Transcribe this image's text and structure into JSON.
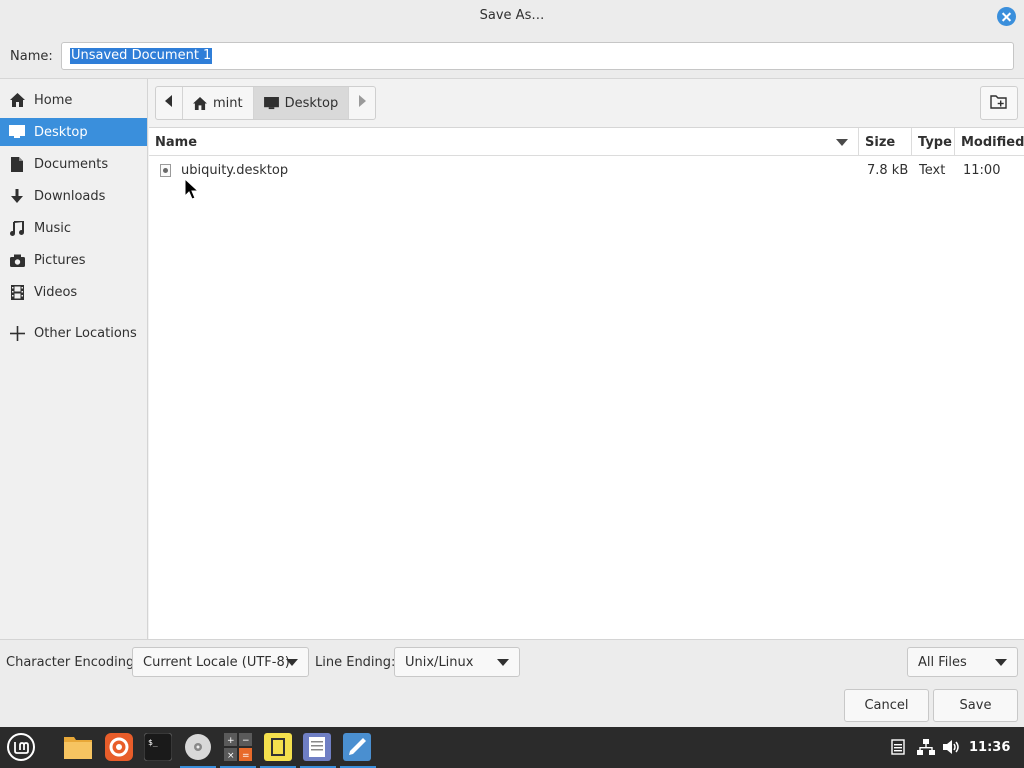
{
  "window": {
    "title": "Save As…"
  },
  "name_row": {
    "label": "Name:",
    "value": "Unsaved Document 1"
  },
  "sidebar": {
    "items": [
      {
        "label": "Home",
        "icon": "home-icon",
        "active": false
      },
      {
        "label": "Desktop",
        "icon": "desktop-icon",
        "active": true
      },
      {
        "label": "Documents",
        "icon": "document-icon",
        "active": false
      },
      {
        "label": "Downloads",
        "icon": "download-icon",
        "active": false
      },
      {
        "label": "Music",
        "icon": "music-icon",
        "active": false
      },
      {
        "label": "Pictures",
        "icon": "camera-icon",
        "active": false
      },
      {
        "label": "Videos",
        "icon": "film-icon",
        "active": false
      },
      {
        "label": "Other Locations",
        "icon": "plus-icon",
        "active": false
      }
    ]
  },
  "pathbar": {
    "items": [
      {
        "label": "mint",
        "icon": "home-icon"
      },
      {
        "label": "Desktop",
        "icon": "desktop-icon",
        "current": true
      }
    ]
  },
  "filelist": {
    "columns": [
      "Name",
      "Size",
      "Type",
      "Modified"
    ],
    "rows": [
      {
        "name": "ubiquity.desktop",
        "size": "7.8 kB",
        "type": "Text",
        "modified": "11:00"
      }
    ]
  },
  "options": {
    "encoding_label": "Character Encoding:",
    "encoding_value": "Current Locale (UTF-8)",
    "line_ending_label": "Line Ending:",
    "line_ending_value": "Unix/Linux",
    "filter_value": "All Files"
  },
  "buttons": {
    "cancel": "Cancel",
    "save": "Save"
  },
  "taskbar": {
    "clock": "11:36",
    "apps": [
      "menu-icon",
      "files-icon",
      "firefox-icon",
      "terminal-icon",
      "disc-icon",
      "calculator-icon",
      "notes-icon",
      "text-editor-icon",
      "text-editor-pen-icon"
    ]
  },
  "colors": {
    "accent": "#3a8fdc",
    "taskbar": "#2b2b2b"
  }
}
